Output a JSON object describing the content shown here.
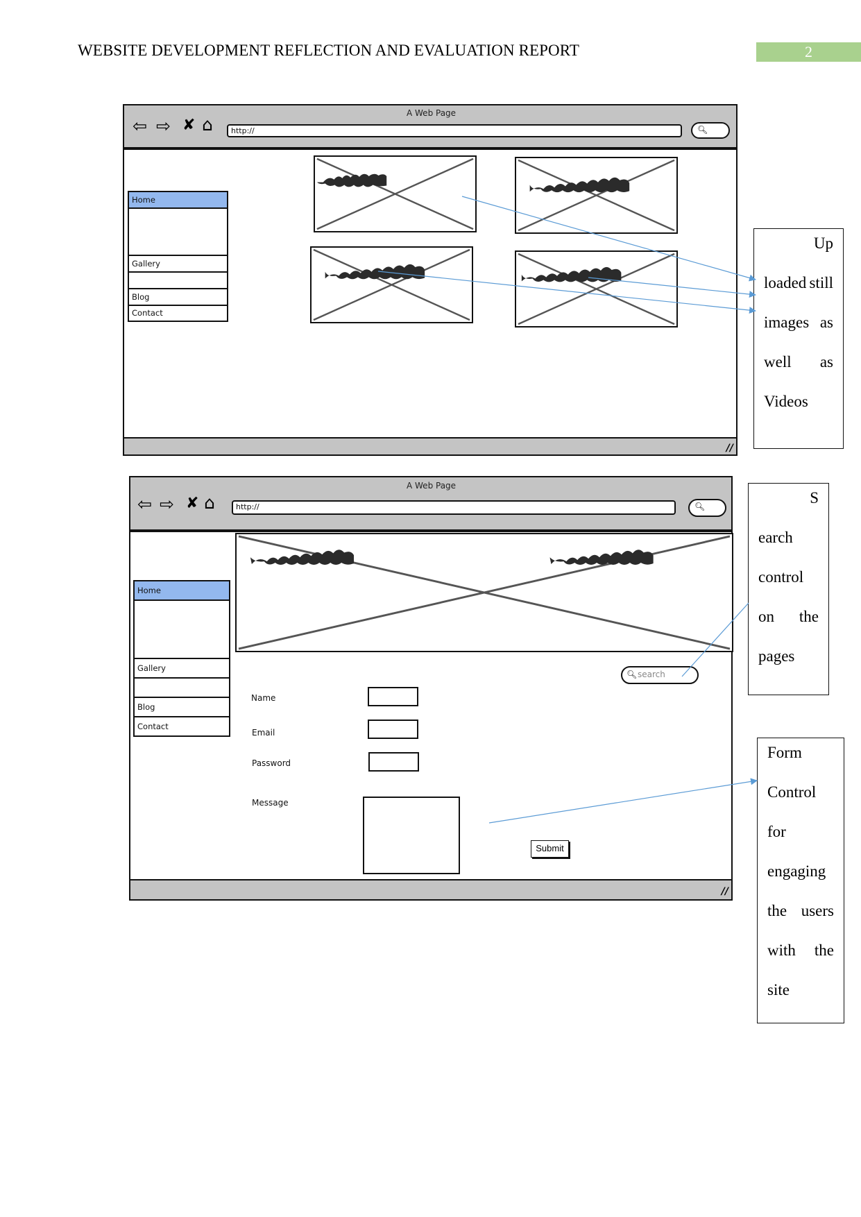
{
  "header": {
    "title": "WEBSITE DEVELOPMENT REFLECTION AND EVALUATION REPORT",
    "page_number": "2"
  },
  "colors": {
    "page_number_bg": "#A9D18E",
    "active_nav": "#93B8EE",
    "toolbar": "#C4C4C4",
    "arrow": "#5B9BD5"
  },
  "wireframes": [
    {
      "window_title": "A Web Page",
      "url": "http://",
      "nav_icons": [
        "back-arrow-icon",
        "forward-arrow-icon",
        "close-x-icon",
        "home-icon"
      ],
      "sidebar": [
        {
          "label": "Home",
          "active": true
        },
        {
          "label": ""
        },
        {
          "label": "Gallery"
        },
        {
          "label": ""
        },
        {
          "label": "Blog"
        },
        {
          "label": "Contact"
        }
      ],
      "images": [
        "image-placeholder",
        "image-placeholder",
        "image-placeholder",
        "image-placeholder"
      ]
    },
    {
      "window_title": "A Web Page",
      "url": "http://",
      "nav_icons": [
        "back-arrow-icon",
        "forward-arrow-icon",
        "close-x-icon",
        "home-icon"
      ],
      "sidebar": [
        {
          "label": "Home",
          "active": true
        },
        {
          "label": ""
        },
        {
          "label": "Gallery"
        },
        {
          "label": ""
        },
        {
          "label": "Blog"
        },
        {
          "label": "Contact"
        }
      ],
      "search_placeholder": "search",
      "form": {
        "fields": [
          {
            "label": "Name"
          },
          {
            "label": "Email"
          },
          {
            "label": "Password"
          },
          {
            "label": "Message"
          }
        ],
        "submit_label": "Submit"
      }
    }
  ],
  "callouts": [
    {
      "lines": [
        [
          "Up"
        ],
        [
          "loaded",
          "still"
        ],
        [
          "images",
          "as"
        ],
        [
          "well",
          "as"
        ],
        [
          "Videos"
        ]
      ]
    },
    {
      "lines": [
        [
          "S"
        ],
        [
          "earch"
        ],
        [
          "control"
        ],
        [
          "on",
          "the"
        ],
        [
          "pages"
        ]
      ]
    },
    {
      "lines": [
        [
          "Form"
        ],
        [
          "Control"
        ],
        [
          "for"
        ],
        [
          "engaging"
        ],
        [
          "the",
          "users"
        ],
        [
          "with",
          "the"
        ],
        [
          "site"
        ]
      ]
    }
  ]
}
